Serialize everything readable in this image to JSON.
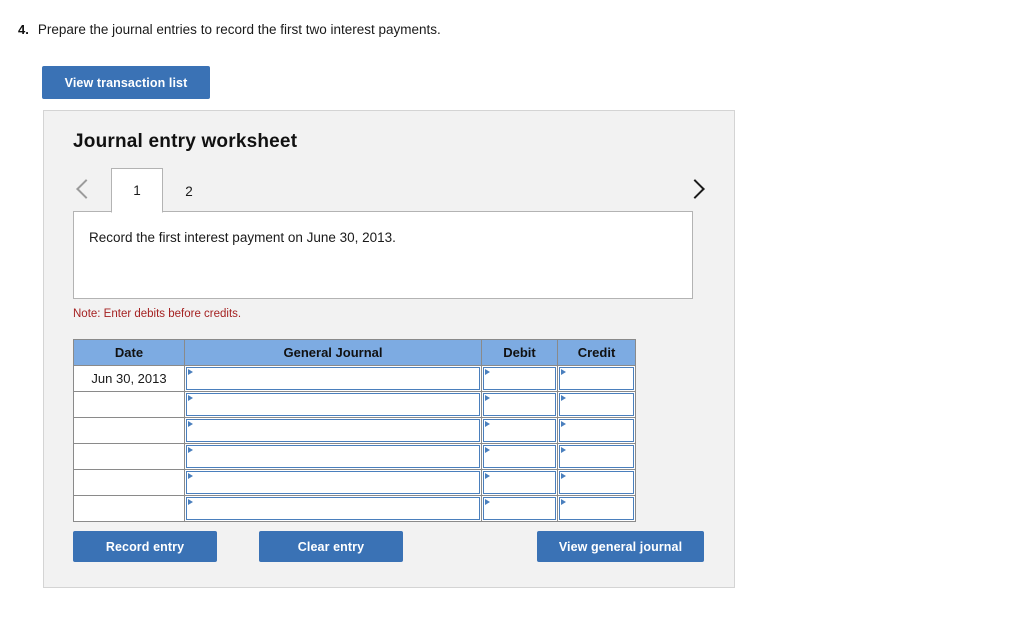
{
  "question": {
    "number": "4.",
    "text": "Prepare the journal entries to record the first two interest payments."
  },
  "toolbar": {
    "view_transaction_list": "View transaction list"
  },
  "panel": {
    "title": "Journal entry worksheet",
    "nav": {
      "prev_icon": "chevron-left-icon",
      "next_icon": "chevron-right-icon"
    },
    "tabs": [
      {
        "label": "1",
        "active": true
      },
      {
        "label": "2",
        "active": false
      }
    ],
    "instruction": "Record the first interest payment on June 30, 2013.",
    "note": "Note: Enter debits before credits.",
    "table": {
      "columns": [
        "Date",
        "General Journal",
        "Debit",
        "Credit"
      ],
      "rows": [
        {
          "date": "Jun 30, 2013",
          "general_journal": "",
          "debit": "",
          "credit": ""
        },
        {
          "date": "",
          "general_journal": "",
          "debit": "",
          "credit": ""
        },
        {
          "date": "",
          "general_journal": "",
          "debit": "",
          "credit": ""
        },
        {
          "date": "",
          "general_journal": "",
          "debit": "",
          "credit": ""
        },
        {
          "date": "",
          "general_journal": "",
          "debit": "",
          "credit": ""
        },
        {
          "date": "",
          "general_journal": "",
          "debit": "",
          "credit": ""
        }
      ]
    },
    "actions": {
      "record_entry": "Record entry",
      "clear_entry": "Clear entry",
      "view_general_journal": "View general journal"
    }
  },
  "colors": {
    "button_blue": "#3a72b5",
    "table_header_blue": "#7dabe2",
    "panel_background": "#f2f2f2",
    "note_red": "#a52222",
    "cell_border_blue": "#4a7fbd"
  }
}
